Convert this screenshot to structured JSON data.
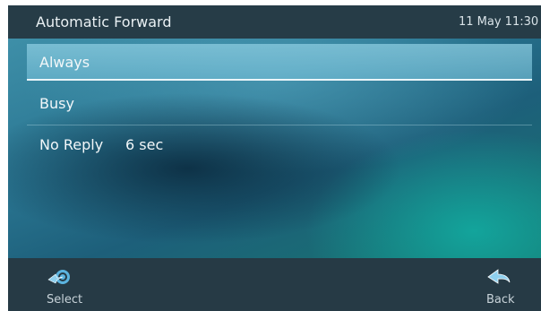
{
  "header": {
    "title": "Automatic Forward",
    "datetime": "11 May 11:30"
  },
  "menu": {
    "items": [
      {
        "label": "Always",
        "value": "",
        "selected": true
      },
      {
        "label": "Busy",
        "value": ""
      },
      {
        "label": "No Reply",
        "value": "6 sec"
      }
    ]
  },
  "softkeys": {
    "select": {
      "label": "Select",
      "icon": "select-arrow-icon"
    },
    "back": {
      "label": "Back",
      "icon": "back-arrow-icon"
    }
  },
  "colors": {
    "header_bg": "#263c47",
    "softkey_bg": "#263a45",
    "accent_icon": "#5bb4e0"
  }
}
